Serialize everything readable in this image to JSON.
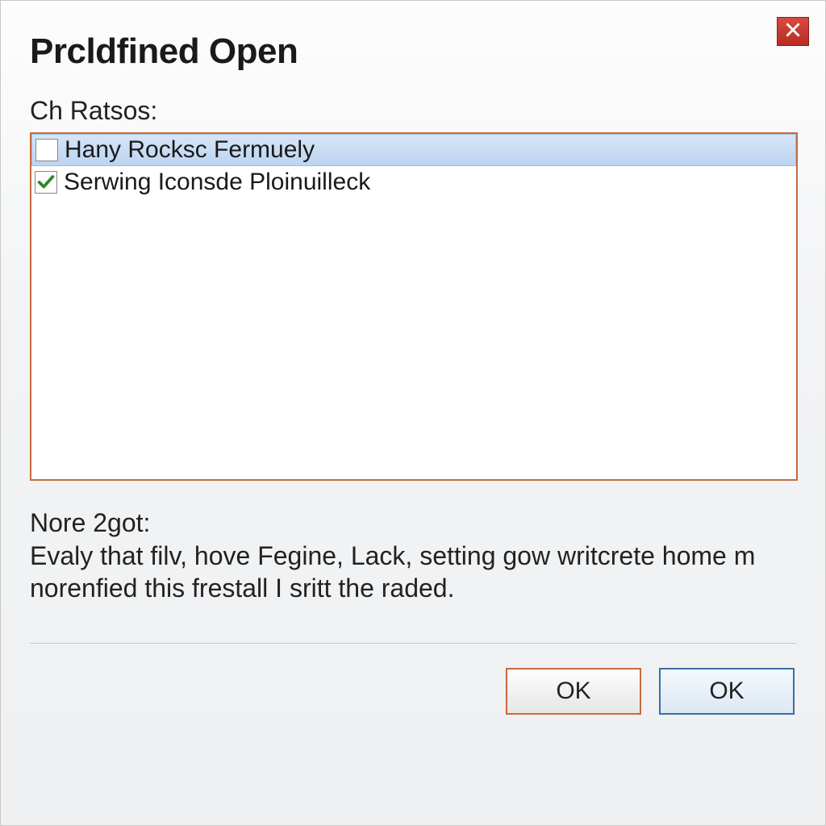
{
  "dialog": {
    "title": "Prcldfined Open",
    "list_label": "Ch Ratsos:",
    "items": [
      {
        "label": "Hany Rocksc Fermuely",
        "checked": false,
        "selected": true
      },
      {
        "label": "Serwing Iconsde Ploinuilleck",
        "checked": true,
        "selected": false
      }
    ],
    "description_label": "Nore 2got:",
    "description_text": "Evaly that filv, hove Fegine, Lack, setting gow writcrete home m norenfied this frestall I sritt the raded.",
    "buttons": {
      "ok_primary": "OK",
      "ok_default": "OK"
    }
  },
  "colors": {
    "accent_border": "#c76a3e",
    "close_bg": "#c0392b",
    "default_btn_border": "#3a6ea5"
  }
}
